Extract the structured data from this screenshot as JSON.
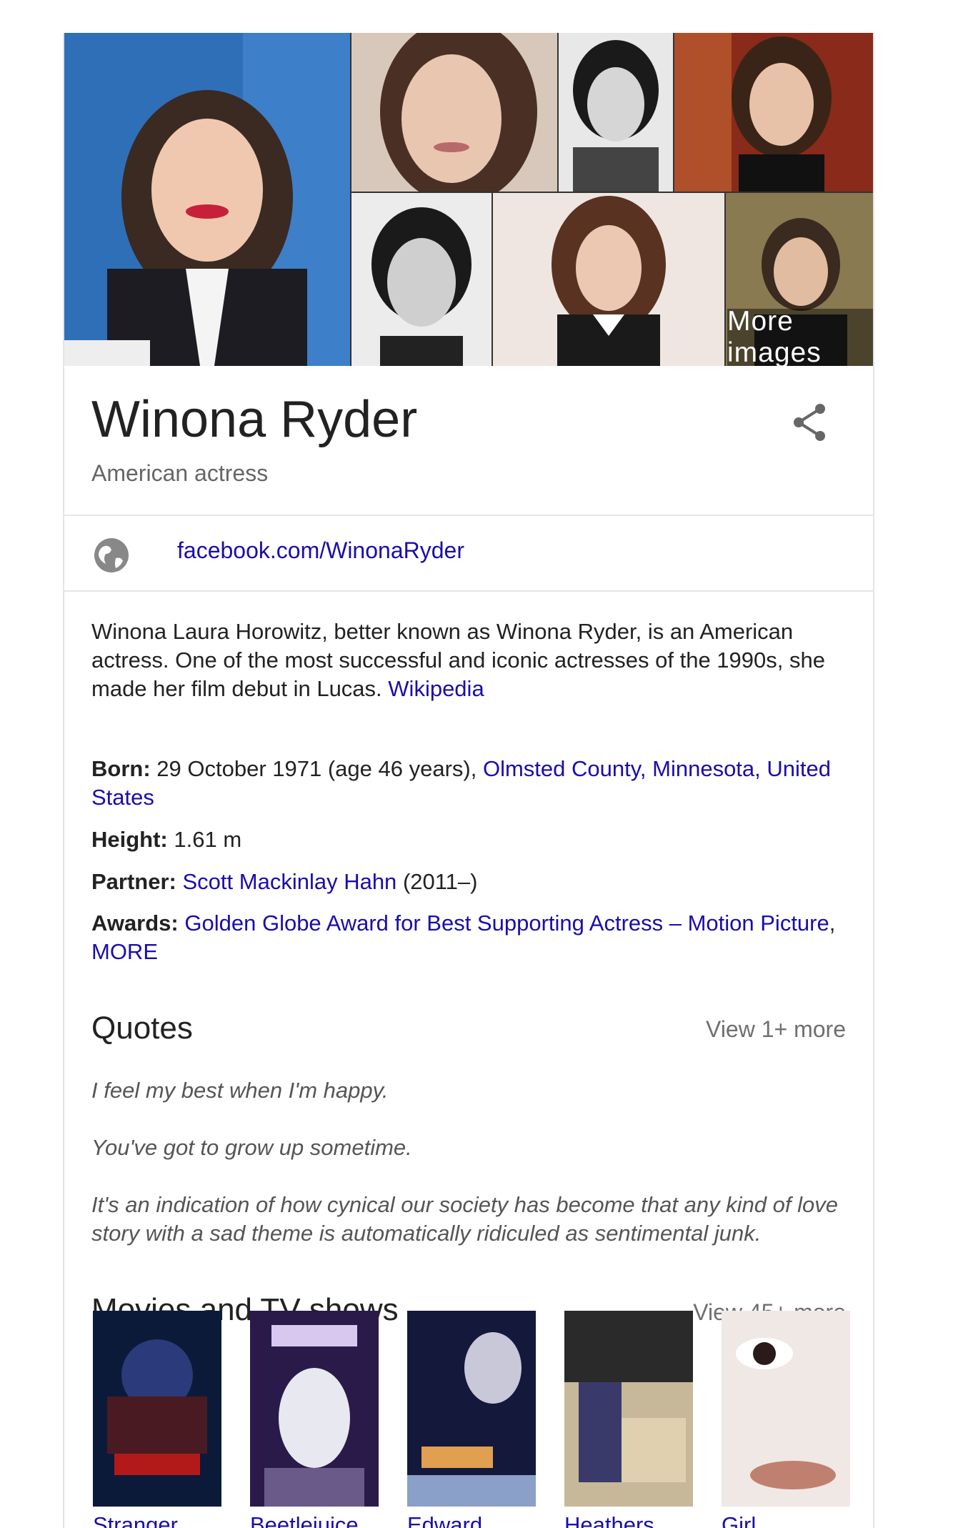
{
  "gallery": {
    "more_images_label": "More images"
  },
  "entity": {
    "name": "Winona Ryder",
    "subtitle": "American actress",
    "website": "facebook.com/WinonaRyder"
  },
  "description": {
    "text": "Winona Laura Horowitz, better known as Winona Ryder, is an American actress. One of the most successful and iconic actresses of the 1990s, she made her film debut in Lucas.",
    "source_link": "Wikipedia"
  },
  "facts": {
    "born": {
      "label": "Born:",
      "text": "29 October 1971 (age 46 years),",
      "link": "Olmsted County, Minnesota, United States"
    },
    "height": {
      "label": "Height:",
      "text": "1.61 m"
    },
    "partner": {
      "label": "Partner:",
      "link": "Scott Mackinlay Hahn",
      "text": "(2011–)"
    },
    "awards": {
      "label": "Awards:",
      "link": "Golden Globe Award for Best Supporting Actress – Motion Picture",
      "sep": ",",
      "more": "MORE"
    }
  },
  "quotes": {
    "title": "Quotes",
    "view_more": "View 1+ more",
    "items": [
      "I feel my best when I'm happy.",
      "You've got to grow up sometime.",
      "It's an indication of how cynical our society has become that any kind of love story with a sad theme is automatically ridiculed as sentimental junk."
    ]
  },
  "movies": {
    "title": "Movies and TV shows",
    "view_more": "View 45+ more",
    "items": [
      {
        "label": "Stranger"
      },
      {
        "label": "Beetlejuice"
      },
      {
        "label": "Edward"
      },
      {
        "label": "Heathers"
      },
      {
        "label": "Girl"
      }
    ]
  },
  "colors": {
    "link": "#1a0dab",
    "muted": "#6f6f6f",
    "divider": "#e6e6e6"
  }
}
